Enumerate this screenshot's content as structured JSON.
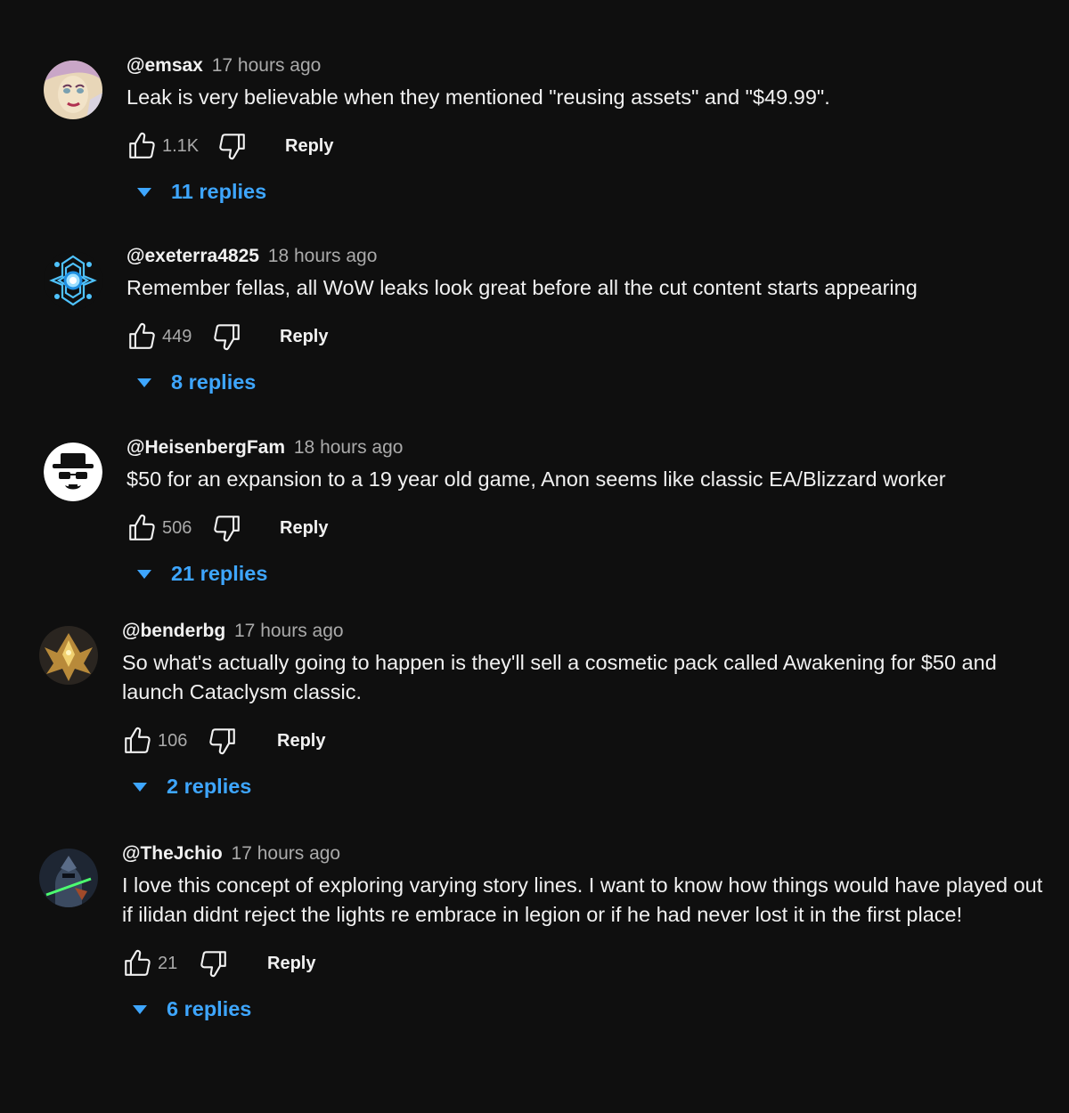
{
  "comments": [
    {
      "author": "@emsax",
      "time": "17 hours ago",
      "text": "Leak is very believable when they mentioned \"reusing assets\" and \"$49.99\".",
      "likes": "1.1K",
      "reply_label": "Reply",
      "replies_label": "11 replies",
      "avatar_icon": "anime-face-avatar"
    },
    {
      "author": "@exeterra4825",
      "time": "18 hours ago",
      "text": "Remember fellas, all WoW leaks look great before all the cut content starts appearing",
      "likes": "449",
      "reply_label": "Reply",
      "replies_label": "8 replies",
      "avatar_icon": "blue-glowing-emblem-avatar"
    },
    {
      "author": "@HeisenbergFam",
      "time": "18 hours ago",
      "text": "$50 for an expansion to a 19 year old game, Anon seems like classic EA/Blizzard worker",
      "likes": "506",
      "reply_label": "Reply",
      "replies_label": "21 replies",
      "avatar_icon": "heisenberg-hat-glasses-avatar"
    },
    {
      "author": "@benderbg",
      "time": "17 hours ago",
      "text": "So what's actually going to happen is they'll sell a cosmetic pack called Awakening for $50 and launch Cataclysm classic.",
      "likes": "106",
      "reply_label": "Reply",
      "replies_label": "2 replies",
      "avatar_icon": "golden-winged-figure-avatar"
    },
    {
      "author": "@TheJchio",
      "time": "17 hours ago",
      "text": "I love this concept of exploring varying story lines. I want to know how things would have played out if ilidan didnt reject the lights re embrace in legion or if he had never lost it in the first place!",
      "likes": "21",
      "reply_label": "Reply",
      "replies_label": "6 replies",
      "avatar_icon": "armored-warrior-avatar"
    }
  ],
  "icons": {
    "like": "thumbs-up-icon",
    "dislike": "thumbs-down-icon",
    "expand": "caret-down-icon"
  },
  "colors": {
    "background": "#0f0f0f",
    "text": "#f1f1f1",
    "secondary_text": "#aaaaaa",
    "link": "#3ea6ff"
  }
}
